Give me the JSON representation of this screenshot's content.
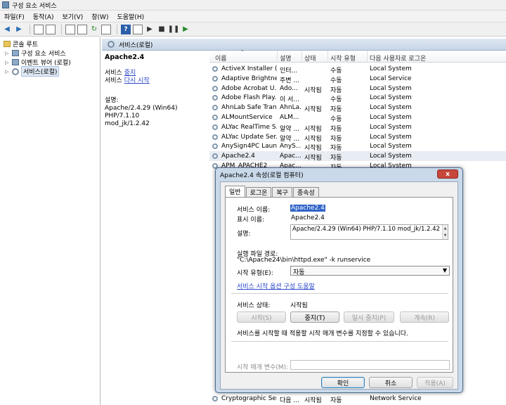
{
  "window": {
    "title": "구성 요소 서비스"
  },
  "menu": [
    "파일(F)",
    "동작(A)",
    "보기(V)",
    "창(W)",
    "도움말(H)"
  ],
  "tree": {
    "items": [
      {
        "label": "콘솔 루트",
        "expander": ""
      },
      {
        "label": "구성 요소 서비스",
        "expander": "▷"
      },
      {
        "label": "이벤트 뷰어 (로컬)",
        "expander": "▷"
      },
      {
        "label": "서비스(로컬)",
        "expander": "▷"
      }
    ]
  },
  "right_header": {
    "title": "서비스(로컬)"
  },
  "description": {
    "service_name": "Apache2.4",
    "stop_prefix": "서비스 ",
    "stop_link": "중지",
    "restart_prefix": "서비스 ",
    "restart_link": "다시 시작",
    "desc_label": "설명:",
    "desc_line1": "Apache/2.4.29 (Win64) PHP/7.1.10",
    "desc_line2": "mod_jk/1.2.42"
  },
  "list": {
    "columns": [
      "이름",
      "설명",
      "상태",
      "시작 유형",
      "다음 사용자로 로그온"
    ],
    "rows": [
      {
        "name": "ActiveX Installer (...",
        "desc": "인터...",
        "status": "",
        "startup": "수동",
        "logon": "Local System"
      },
      {
        "name": "Adaptive Brightness",
        "desc": "주변 ...",
        "status": "",
        "startup": "수동",
        "logon": "Local Service"
      },
      {
        "name": "Adobe Acrobat U...",
        "desc": "Ado...",
        "status": "시작됨",
        "startup": "자동",
        "logon": "Local System"
      },
      {
        "name": "Adobe Flash Play...",
        "desc": "이 서...",
        "status": "",
        "startup": "수동",
        "logon": "Local System"
      },
      {
        "name": "AhnLab Safe Tran...",
        "desc": "AhnLa...",
        "status": "시작됨",
        "startup": "자동",
        "logon": "Local System"
      },
      {
        "name": "ALMountService",
        "desc": "ALM...",
        "status": "",
        "startup": "수동",
        "logon": "Local System"
      },
      {
        "name": "ALYac RealTime S...",
        "desc": "알약 ...",
        "status": "시작됨",
        "startup": "자동",
        "logon": "Local System"
      },
      {
        "name": "ALYac Update Ser...",
        "desc": "알약 ...",
        "status": "시작됨",
        "startup": "자동",
        "logon": "Local System"
      },
      {
        "name": "AnySign4PC Laun...",
        "desc": "AnyS...",
        "status": "시작됨",
        "startup": "자동",
        "logon": "Local System"
      },
      {
        "name": "Apache2.4",
        "desc": "Apac...",
        "status": "시작됨",
        "startup": "자동",
        "logon": "Local System"
      },
      {
        "name": "APM_APACHE2",
        "desc": "Apac...",
        "status": "",
        "startup": "자동",
        "logon": "Local System"
      }
    ],
    "bottom_row": {
      "name": "Cryptographic Ser...",
      "desc": "다음 ...",
      "status": "시작됨",
      "startup": "자동",
      "logon": "Network Service"
    }
  },
  "dialog": {
    "title": "Apache2.4 속성(로컬 컴퓨터)",
    "close": "x",
    "tabs": [
      "일반",
      "로그온",
      "복구",
      "종속성"
    ],
    "service_name_label": "서비스 이름:",
    "service_name_value": "Apache2.4",
    "display_name_label": "표시 이름:",
    "display_name_value": "Apache2.4",
    "desc_label": "설명:",
    "desc_value": "Apache/2.4.29 (Win64) PHP/7.1.10 mod_jk/1.2.42",
    "exe_label": "실행 파일 경로:",
    "exe_value": "\"C:\\Apache24\\bin\\httpd.exe\" -k runservice",
    "startup_label": "시작 유형(E):",
    "startup_value": "자동",
    "help_link": "서비스 시작 옵션 구성 도움말",
    "status_label": "서비스 상태:",
    "status_value": "시작됨",
    "btn_start": "시작(S)",
    "btn_stop": "중지(T)",
    "btn_pause": "일시 중지(P)",
    "btn_resume": "계속(R)",
    "note": "서비스를 시작할 때 적용할 시작 매개 변수를 지정할 수 있습니다.",
    "param_label": "시작 매개 변수(M):",
    "btn_ok": "확인",
    "btn_cancel": "취소",
    "btn_apply": "적용(A)"
  }
}
